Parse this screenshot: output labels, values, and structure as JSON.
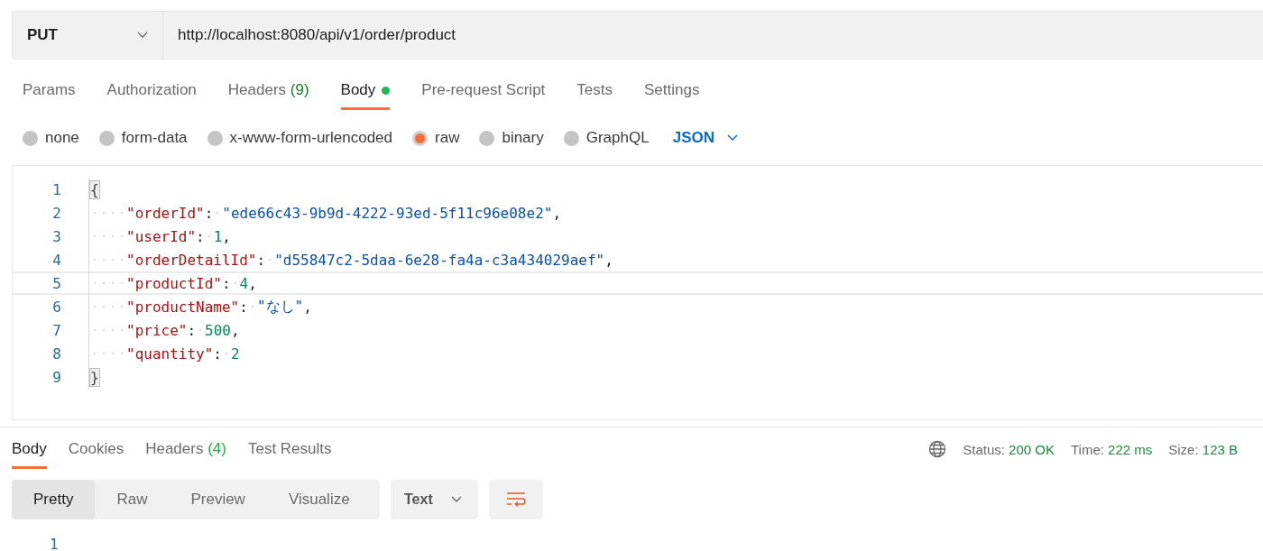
{
  "request": {
    "method": "PUT",
    "url": "http://localhost:8080/api/v1/order/product"
  },
  "request_tabs": [
    {
      "label": "Params",
      "selected": false
    },
    {
      "label": "Authorization",
      "selected": false
    },
    {
      "label": "Headers",
      "count": "(9)",
      "selected": false
    },
    {
      "label": "Body",
      "selected": true,
      "has_content": true
    },
    {
      "label": "Pre-request Script",
      "selected": false
    },
    {
      "label": "Tests",
      "selected": false
    },
    {
      "label": "Settings",
      "selected": false
    }
  ],
  "body_types": [
    {
      "label": "none",
      "selected": false
    },
    {
      "label": "form-data",
      "selected": false
    },
    {
      "label": "x-www-form-urlencoded",
      "selected": false
    },
    {
      "label": "raw",
      "selected": true
    },
    {
      "label": "binary",
      "selected": false
    },
    {
      "label": "GraphQL",
      "selected": false
    }
  ],
  "format": "JSON",
  "editor_lines": [
    {
      "number": "1",
      "indent": false,
      "current": false,
      "tokens": [
        {
          "kind": "brace",
          "text": "{"
        }
      ]
    },
    {
      "number": "2",
      "indent": true,
      "current": false,
      "tokens": [
        {
          "kind": "key",
          "text": "\"orderId\""
        },
        {
          "kind": "punct",
          "text": ":"
        },
        {
          "kind": "space"
        },
        {
          "kind": "string",
          "text": "\"ede66c43-9b9d-4222-93ed-5f11c96e08e2\""
        },
        {
          "kind": "punct",
          "text": ","
        }
      ]
    },
    {
      "number": "3",
      "indent": true,
      "current": false,
      "tokens": [
        {
          "kind": "key",
          "text": "\"userId\""
        },
        {
          "kind": "punct",
          "text": ":"
        },
        {
          "kind": "space"
        },
        {
          "kind": "number",
          "text": "1"
        },
        {
          "kind": "punct",
          "text": ","
        }
      ]
    },
    {
      "number": "4",
      "indent": true,
      "current": false,
      "tokens": [
        {
          "kind": "key",
          "text": "\"orderDetailId\""
        },
        {
          "kind": "punct",
          "text": ":"
        },
        {
          "kind": "space"
        },
        {
          "kind": "string",
          "text": "\"d55847c2-5daa-6e28-fa4a-c3a434029aef\""
        },
        {
          "kind": "punct",
          "text": ","
        }
      ]
    },
    {
      "number": "5",
      "indent": true,
      "current": true,
      "tokens": [
        {
          "kind": "key",
          "text": "\"productId\""
        },
        {
          "kind": "punct",
          "text": ":"
        },
        {
          "kind": "space"
        },
        {
          "kind": "number",
          "text": "4"
        },
        {
          "kind": "punct",
          "text": ","
        }
      ]
    },
    {
      "number": "6",
      "indent": true,
      "current": false,
      "tokens": [
        {
          "kind": "key",
          "text": "\"productName\""
        },
        {
          "kind": "punct",
          "text": ":"
        },
        {
          "kind": "space"
        },
        {
          "kind": "string",
          "text": "\"なし\""
        },
        {
          "kind": "punct",
          "text": ","
        }
      ]
    },
    {
      "number": "7",
      "indent": true,
      "current": false,
      "tokens": [
        {
          "kind": "key",
          "text": "\"price\""
        },
        {
          "kind": "punct",
          "text": ":"
        },
        {
          "kind": "space"
        },
        {
          "kind": "number",
          "text": "500"
        },
        {
          "kind": "punct",
          "text": ","
        }
      ]
    },
    {
      "number": "8",
      "indent": true,
      "current": false,
      "tokens": [
        {
          "kind": "key",
          "text": "\"quantity\""
        },
        {
          "kind": "punct",
          "text": ":"
        },
        {
          "kind": "space"
        },
        {
          "kind": "number",
          "text": "2"
        }
      ]
    },
    {
      "number": "9",
      "indent": false,
      "current": false,
      "tokens": [
        {
          "kind": "brace",
          "text": "}"
        }
      ]
    }
  ],
  "response_tabs": [
    {
      "label": "Body",
      "selected": true
    },
    {
      "label": "Cookies",
      "selected": false
    },
    {
      "label": "Headers",
      "count": "(4)",
      "selected": false
    },
    {
      "label": "Test Results",
      "selected": false
    }
  ],
  "response_status": [
    {
      "label": "Status:",
      "value": "200 OK"
    },
    {
      "label": "Time:",
      "value": "222 ms"
    },
    {
      "label": "Size:",
      "value": "123 B"
    }
  ],
  "view_modes": [
    {
      "label": "Pretty",
      "selected": true
    },
    {
      "label": "Raw",
      "selected": false
    },
    {
      "label": "Preview",
      "selected": false
    },
    {
      "label": "Visualize",
      "selected": false
    }
  ],
  "response_format": "Text",
  "response_lines": [
    "1"
  ]
}
